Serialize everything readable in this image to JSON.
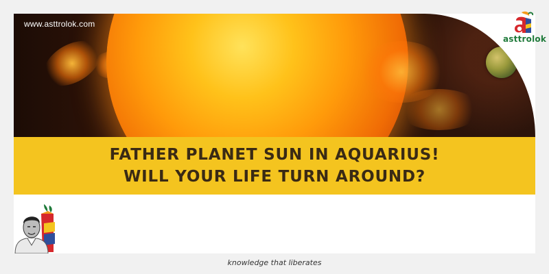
{
  "header": {
    "site_url": "www.asttrolok.com"
  },
  "brand": {
    "name": "asttrolok",
    "logo_icon": "asttrolok-logo-icon",
    "colors": {
      "green": "#1f7a3a",
      "orange": "#f59a1b",
      "red": "#d6282c",
      "blue": "#2f4f9c"
    }
  },
  "banner": {
    "title_line1": "FATHER PLANET SUN IN AQUARIUS!",
    "title_line2": "WILL YOUR LIFE TURN AROUND?",
    "band_color": "#f4c41f",
    "title_color": "#3a2a14"
  },
  "footer": {
    "tagline": "knowledge that liberates"
  }
}
